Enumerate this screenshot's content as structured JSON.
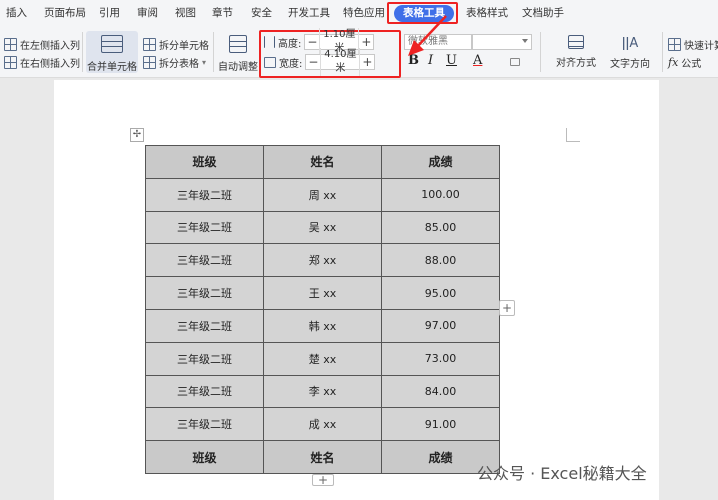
{
  "menu": {
    "tabs": [
      "插入",
      "页面布局",
      "引用",
      "审阅",
      "视图",
      "章节",
      "安全",
      "开发工具",
      "特色应用",
      "表格工具",
      "表格样式",
      "文档助手"
    ],
    "active_tab": "表格工具"
  },
  "ribbon": {
    "insert_left_col": "在左侧插入列",
    "insert_right_col": "在右侧插入列",
    "merge_cells": "合并单元格",
    "split_cells": "拆分单元格",
    "split_table": "拆分表格",
    "auto_fit": "自动调整",
    "height_label": "高度:",
    "height_value": "1.10厘米",
    "width_label": "宽度:",
    "width_value": "4.10厘米",
    "font_name": "微软雅黑",
    "bold": "B",
    "italic": "I",
    "underline": "U",
    "font_color": "A",
    "align": "对齐方式",
    "text_direction": "文字方向",
    "quick_calc": "快速计算",
    "formula": "公式",
    "minus": "−",
    "plus": "+"
  },
  "table": {
    "header": [
      "班级",
      "姓名",
      "成绩"
    ],
    "rows": [
      [
        "三年级二班",
        "周 xx",
        "100.00"
      ],
      [
        "三年级二班",
        "吴 xx",
        "85.00"
      ],
      [
        "三年级二班",
        "郑 xx",
        "88.00"
      ],
      [
        "三年级二班",
        "王 xx",
        "95.00"
      ],
      [
        "三年级二班",
        "韩 xx",
        "97.00"
      ],
      [
        "三年级二班",
        "楚 xx",
        "73.00"
      ],
      [
        "三年级二班",
        "李 xx",
        "84.00"
      ],
      [
        "三年级二班",
        "成 xx",
        "91.00"
      ]
    ],
    "footer": [
      "班级",
      "姓名",
      "成绩"
    ]
  },
  "watermark": "公众号 · Excel秘籍大全",
  "colors": {
    "active_tab": "#3f6fe8",
    "highlight": "#ee2222",
    "table_fill": "#d4d4d4"
  }
}
